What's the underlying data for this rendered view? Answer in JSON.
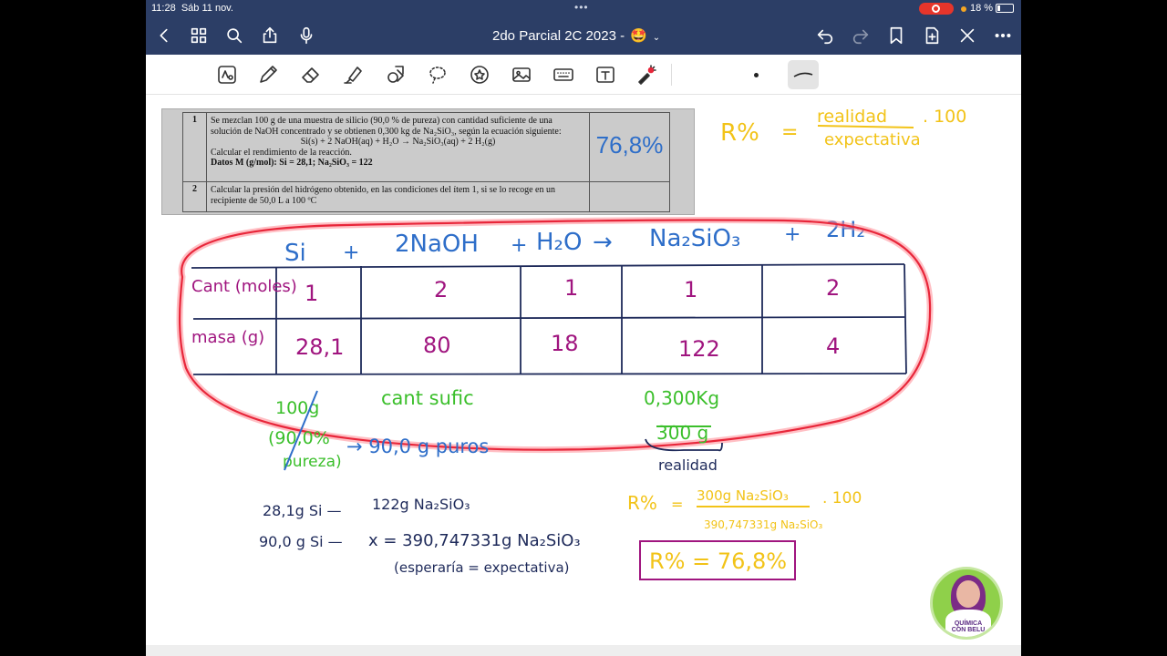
{
  "status_bar": {
    "time": "11:28",
    "date": "Sáb 11 nov.",
    "battery": "18 %",
    "dots": "•••"
  },
  "nav": {
    "title": "2do Parcial 2C 2023 -",
    "emoji": "🤩",
    "chevron": "⌄"
  },
  "colors": {
    "nav_bg": "#2c3e66",
    "ink_blue": "#2e6ec9",
    "ink_navy": "#1e2a5a",
    "ink_magenta": "#a0157f",
    "ink_green": "#3bbf2b",
    "ink_yellow": "#f2c318",
    "highlight_red": "#e8263a"
  },
  "problem": {
    "row1_num": "1",
    "row1_text": "Se mezclan 100 g de una muestra de silicio (90,0 % de pureza) con cantidad suficiente de una solución de NaOH concentrado y se obtienen 0,300 kg de Na₂SiO₃, según la ecuación siguiente:",
    "row1_equation": "Si(s) + 2 NaOH(aq) + H₂O → Na₂SiO₃(aq) + 2 H₂(g)",
    "row1_task": "Calcular el rendimiento de la reacción.",
    "row1_data": "Datos M (g/mol): Si = 28,1; Na₂SiO₃ = 122",
    "row2_num": "2",
    "row2_text": "Calcular la presión del hidrógeno obtenido, en las condiciones del ítem 1, si se lo recoge en un recipiente de 50,0 L a 100 ºC",
    "answer": "76,8%"
  },
  "formula": {
    "r": "R%",
    "eq": "=",
    "num": "realidad",
    "den": "expectativa",
    "factor": ". 100"
  },
  "equation": {
    "si": "Si",
    "plus1": "+",
    "naoh": "2NaOH",
    "plus2": "+",
    "h2o": "H₂O",
    "arrow": "→",
    "na2sio3": "Na₂SiO₃",
    "plus3": "+",
    "h2": "2H₂"
  },
  "table": {
    "row_labels": [
      "Cant (moles)",
      "masa (g)"
    ],
    "moles": [
      "1",
      "2",
      "1",
      "1",
      "2"
    ],
    "masses": [
      "28,1",
      "80",
      "18",
      "122",
      "4"
    ]
  },
  "notes": {
    "sample": "100g",
    "purity": "(90,0%",
    "purity2": "pureza)",
    "pure_result": "→ 90,0 g puros",
    "sufficient": "cant sufic",
    "product_kg": "0,300Kg",
    "product_g": "300 g",
    "real_label": "realidad"
  },
  "calc": {
    "line1_left": "28,1g Si —",
    "line1_right": "122g Na₂SiO₃",
    "line2_left": "90,0 g Si —",
    "line2_right": "x = 390,747331g Na₂SiO₃",
    "line3": "(esperaría = expectativa)"
  },
  "result": {
    "r": "R%",
    "eq": "=",
    "num": "300g Na₂SiO₃",
    "den": "390,747331g Na₂SiO₃",
    "factor": ". 100",
    "final": "R% = 76,8%"
  },
  "logo": {
    "line1": "QUÍMICA",
    "line2": "CON BELU"
  }
}
